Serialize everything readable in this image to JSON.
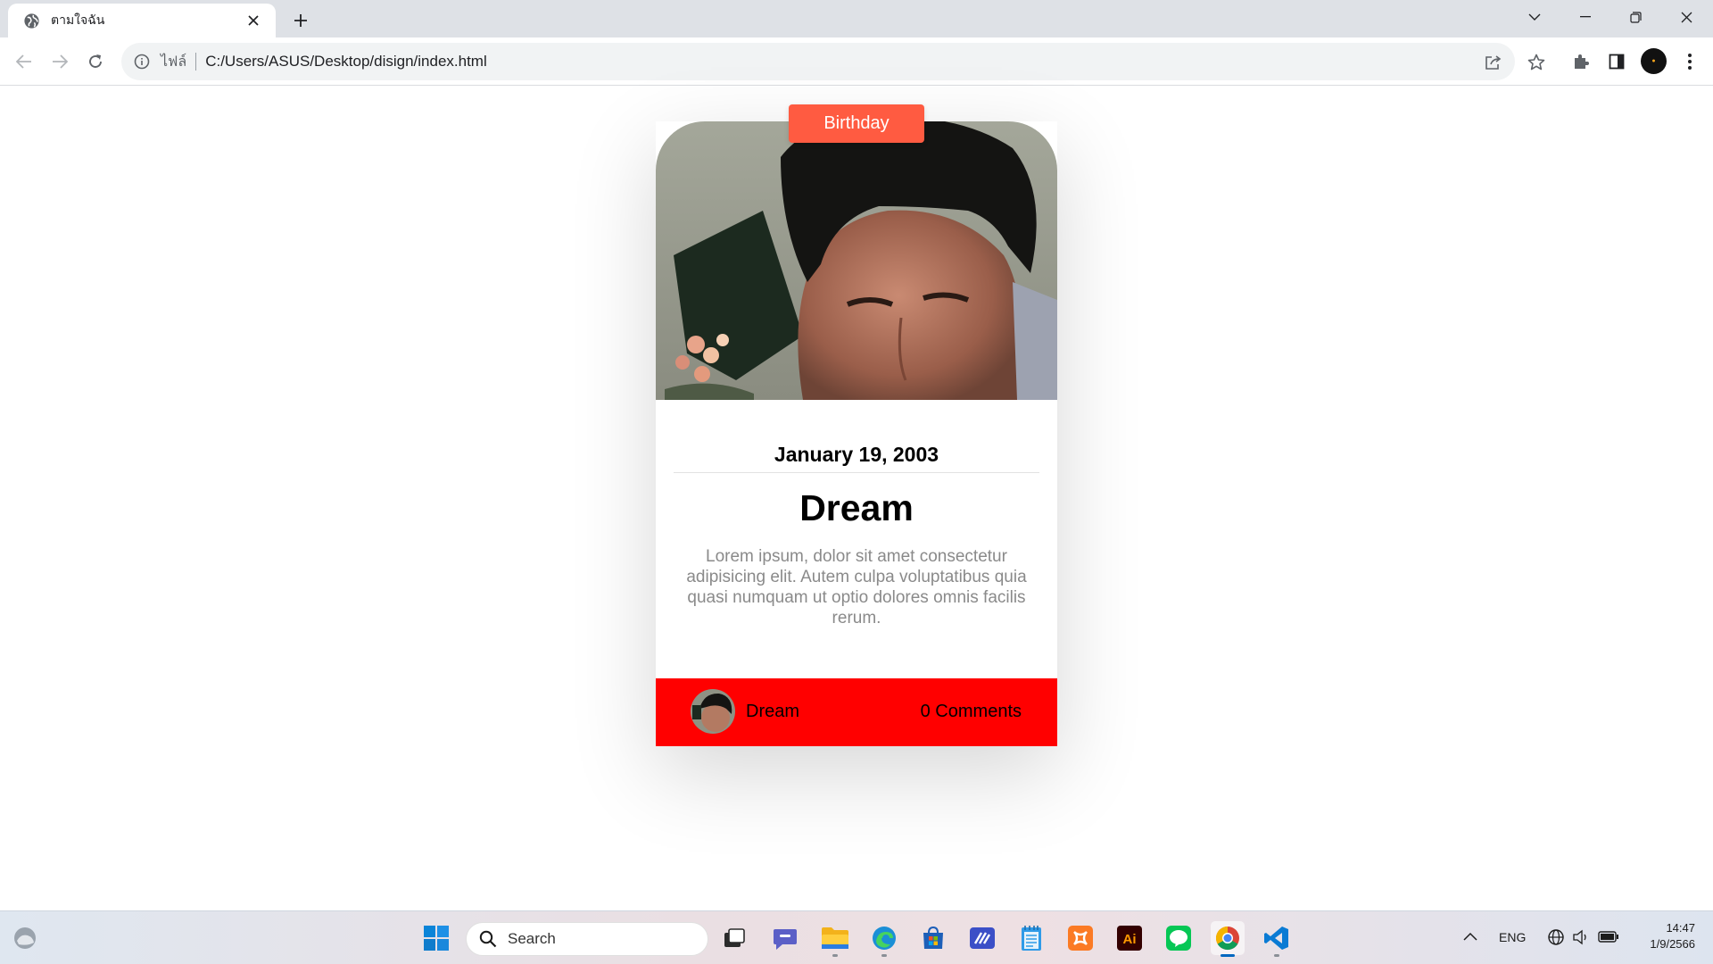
{
  "browser": {
    "tab": {
      "title": "ตามใจฉัน"
    },
    "omnibox": {
      "chip": "ไฟล์",
      "url": "C:/Users/ASUS/Desktop/disign/index.html"
    }
  },
  "card": {
    "badge": "Birthday",
    "date": "January 19, 2003",
    "name": "Dream",
    "description": "Lorem ipsum, dolor sit amet consectetur adipisicing elit. Autem culpa voluptatibus quia quasi numquam ut optio dolores omnis facilis rerum.",
    "footer": {
      "author": "Dream",
      "comments": "0 Comments"
    },
    "colors": {
      "badge": "#ff5b41",
      "footer": "#ff0000"
    }
  },
  "taskbar": {
    "search_label": "Search",
    "apps": [
      "windows-start",
      "search",
      "task-view",
      "teams-chat",
      "file-explorer",
      "edge",
      "microsoft-store",
      "whiteboard",
      "notepad",
      "xampp",
      "illustrator",
      "line",
      "chrome",
      "vscode"
    ],
    "tray": {
      "language": "ENG",
      "time": "14:47",
      "date": "1/9/2566"
    }
  }
}
